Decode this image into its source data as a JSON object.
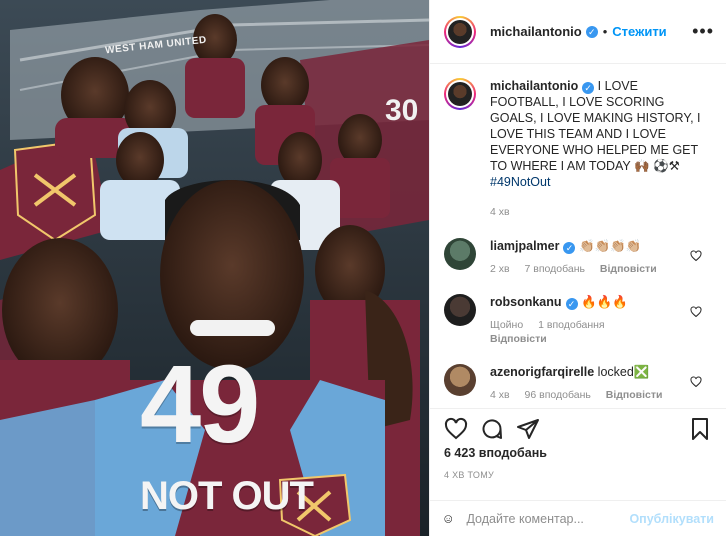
{
  "header": {
    "username": "michailantonio",
    "verified_mark": "✓",
    "separator": "•",
    "follow_label": "Стежити",
    "more_label": "•••"
  },
  "media": {
    "stadium_text": "WEST HAM UNITED",
    "big_number": "49",
    "subtitle": "NOT OUT"
  },
  "caption": {
    "username": "michailantonio",
    "text": " I LOVE FOOTBALL, I LOVE SCORING GOALS, I LOVE MAKING HISTORY, I LOVE THIS TEAM AND I LOVE EVERYONE WHO HELPED ME GET TO WHERE I AM TODAY 🙌🏾 ⚽⚒ ",
    "hashtag": "#49NotOut",
    "time": "4 хв"
  },
  "comments": [
    {
      "username": "liamjpalmer",
      "text": " 👏🏼👏🏼👏🏼👏🏼",
      "time": "2 хв",
      "likes": "7 вподобань",
      "reply": "Відповісти",
      "avatar_color": "#4a6a58"
    },
    {
      "username": "robsonkanu",
      "text": " 🔥🔥🔥",
      "time": "Щойно",
      "likes": "1 вподобання",
      "reply": "Відповісти",
      "avatar_color": "#3a3a3a"
    },
    {
      "username": "azenorigfarqirelle",
      "text": " locked❎",
      "time": "4 хв",
      "likes": "96 вподобань",
      "reply": "Відповісти",
      "avatar_color": "#8a6a4a"
    }
  ],
  "engagement": {
    "likes": "6 423 вподобань",
    "time_ago": "4 ХВ ТОМУ"
  },
  "add_comment": {
    "placeholder": "Додайте коментар...",
    "post_label": "Опублікувати"
  },
  "colors": {
    "accent": "#0095f6",
    "verified": "#3897f0",
    "west_ham_claret": "#7a263a",
    "west_ham_blue": "#5a9ad5"
  }
}
